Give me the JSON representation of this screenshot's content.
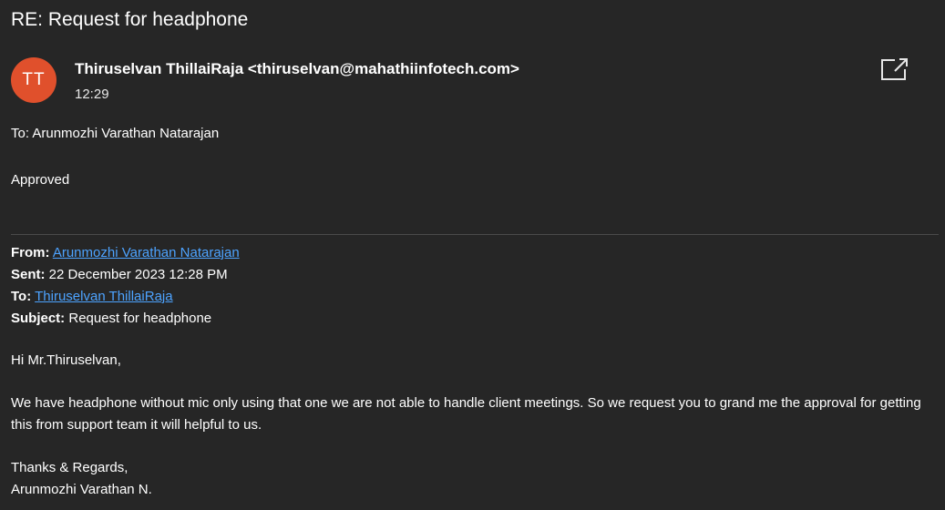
{
  "message": {
    "subject": "RE: Request for headphone",
    "avatar_initials": "TT",
    "avatar_color": "#e0502c",
    "sender": "Thiruselvan ThillaiRaja <thiruselvan@mahathiinfotech.com>",
    "time": "12:29",
    "to_line": "To: Arunmozhi Varathan Natarajan",
    "body": "Approved",
    "popout_icon": "open-in-new-window-icon"
  },
  "quoted": {
    "from_label": "From:",
    "from_value": "Arunmozhi Varathan Natarajan",
    "sent_label": "Sent:",
    "sent_value": "22 December 2023 12:28 PM",
    "to_label": "To:",
    "to_value": "Thiruselvan ThillaiRaja",
    "subject_label": "Subject:",
    "subject_value": "Request for headphone",
    "greeting": "Hi Mr.Thiruselvan,",
    "paragraph": "We have headphone without mic only using that one we are not able to handle client meetings. So we request you to grand me the approval for getting this from support team it will helpful to us.",
    "closing": "Thanks & Regards,",
    "signature": "Arunmozhi Varathan N."
  },
  "colors": {
    "background": "#262626",
    "link": "#4da3ff",
    "divider": "#4a4a4a"
  }
}
